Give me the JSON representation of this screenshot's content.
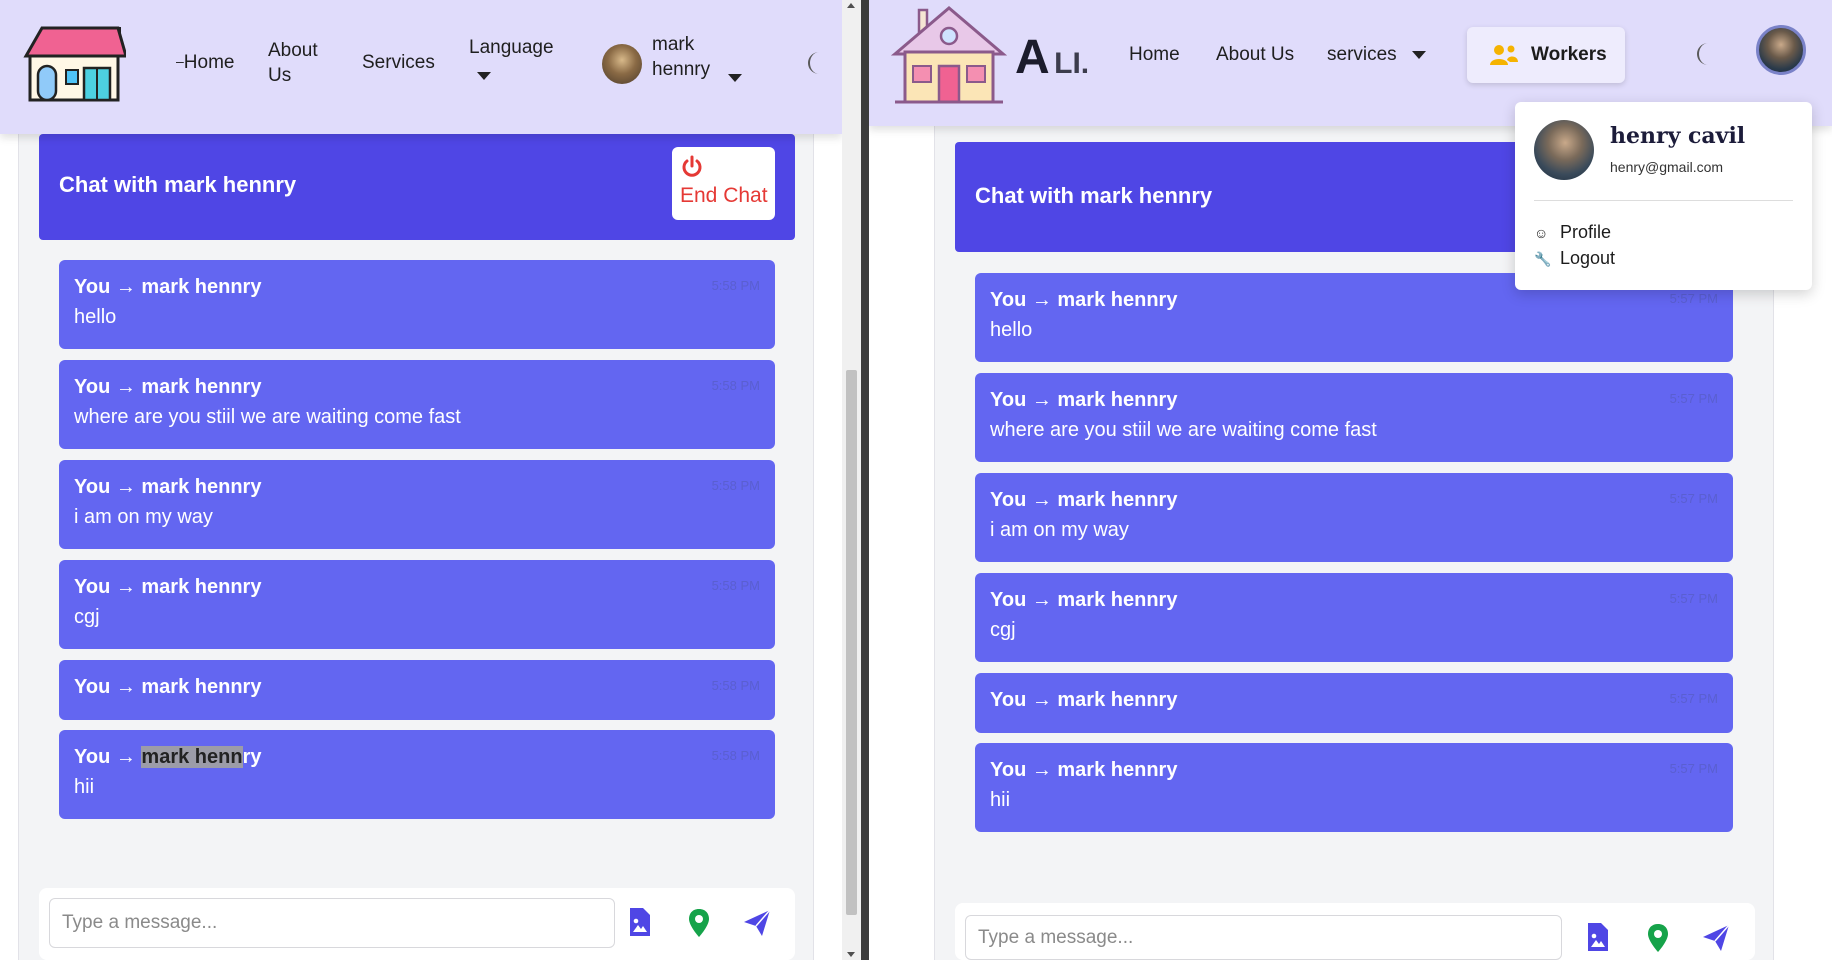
{
  "left": {
    "nav": {
      "home": "Home",
      "about": "About Us",
      "services": "Services",
      "language": "Language",
      "user_name": "mark hennry"
    },
    "chat_title": "Chat with mark hennry",
    "end_chat": "End Chat",
    "messages": [
      {
        "from": "You → mark hennry",
        "text": "hello",
        "time": "5:58 PM"
      },
      {
        "from": "You → mark hennry",
        "text": "where are you stiil we are waiting come fast",
        "time": "5:58 PM"
      },
      {
        "from": "You → mark hennry",
        "text": "i am on my way",
        "time": "5:58 PM"
      },
      {
        "from": "You → mark hennry",
        "text": "cgj",
        "time": "5:58 PM"
      },
      {
        "from": "You → mark hennry",
        "text": "",
        "time": "5:58 PM"
      },
      {
        "from_prefix": "You → ",
        "from_selected": "mark henn",
        "from_suffix": "ry",
        "text": "hii",
        "time": "5:58 PM"
      }
    ],
    "composer_placeholder": "Type a message..."
  },
  "right": {
    "brand": "A LI.",
    "brand_big": "A",
    "brand_small": "LI.",
    "nav": {
      "home": "Home",
      "about": "About Us",
      "services": "services",
      "workers": "Workers"
    },
    "chat_title": "Chat with mark hennry",
    "messages": [
      {
        "from": "You → mark hennry",
        "text": "hello",
        "time": "5:57 PM"
      },
      {
        "from": "You → mark hennry",
        "text": "where are you stiil we are waiting come fast",
        "time": "5:57 PM"
      },
      {
        "from": "You → mark hennry",
        "text": "i am on my way",
        "time": "5:57 PM"
      },
      {
        "from": "You → mark hennry",
        "text": "cgj",
        "time": "5:57 PM"
      },
      {
        "from": "You → mark hennry",
        "text": "",
        "time": "5:57 PM"
      },
      {
        "from": "You → mark hennry",
        "text": "hii",
        "time": "5:57 PM"
      }
    ],
    "composer_placeholder": "Type a message...",
    "dropdown": {
      "name": "henry cavil",
      "email": "henry@gmail.com",
      "profile": "Profile",
      "logout": "Logout"
    }
  },
  "colors": {
    "nav_bg": "#e0dcfb",
    "chat_header": "#4f46e5",
    "bubble": "#6366f1",
    "end_chat": "#e53935",
    "location_icon": "#16a34a",
    "send_icon": "#4f46e5"
  },
  "icons": [
    "house-logo-icon",
    "moon-icon",
    "caret-down-icon",
    "power-icon",
    "image-file-icon",
    "location-pin-icon",
    "send-icon",
    "workers-icon",
    "profile-icon",
    "logout-icon"
  ]
}
